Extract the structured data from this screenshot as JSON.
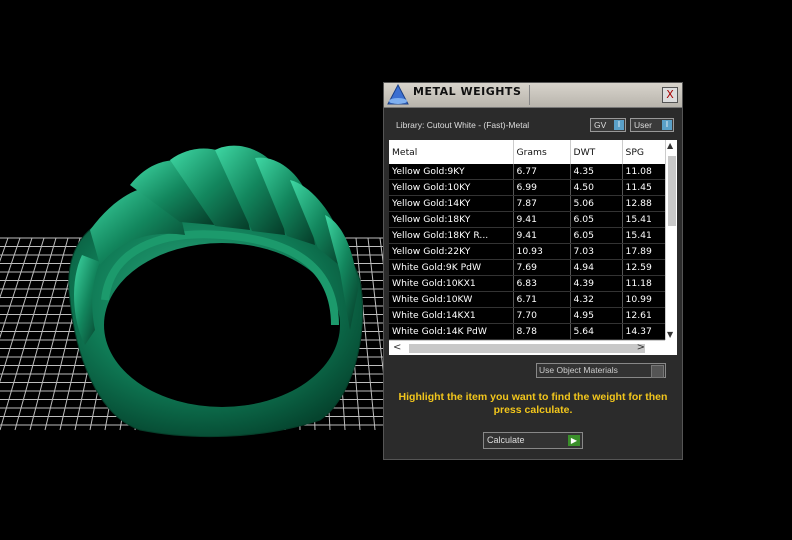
{
  "panel": {
    "title": "METAL WEIGHTS",
    "close_glyph": "X",
    "library_label": "Library: Cutout White - (Fast)-Metal",
    "gv_label": "GV",
    "user_label": "User",
    "toggle_indicator": "I"
  },
  "table": {
    "columns": [
      "Metal",
      "Grams",
      "DWT",
      "SPG"
    ],
    "rows": [
      [
        "Yellow Gold:9KY",
        "6.77",
        "4.35",
        "11.08"
      ],
      [
        "Yellow Gold:10KY",
        "6.99",
        "4.50",
        "11.45"
      ],
      [
        "Yellow Gold:14KY",
        "7.87",
        "5.06",
        "12.88"
      ],
      [
        "Yellow Gold:18KY",
        "9.41",
        "6.05",
        "15.41"
      ],
      [
        "Yellow Gold:18KY R...",
        "9.41",
        "6.05",
        "15.41"
      ],
      [
        "Yellow Gold:22KY",
        "10.93",
        "7.03",
        "17.89"
      ],
      [
        "White Gold:9K PdW",
        "7.69",
        "4.94",
        "12.59"
      ],
      [
        "White Gold:10KX1",
        "6.83",
        "4.39",
        "11.18"
      ],
      [
        "White Gold:10KW",
        "6.71",
        "4.32",
        "10.99"
      ],
      [
        "White Gold:14KX1",
        "7.70",
        "4.95",
        "12.61"
      ],
      [
        "White Gold:14K PdW",
        "8.78",
        "5.64",
        "14.37"
      ]
    ]
  },
  "use_object_materials_label": "Use Object Materials",
  "hint": "Highlight the item you want to find the weight for then press calculate.",
  "calculate_label": "Calculate",
  "colors": {
    "ring": "#0f7a55",
    "grid": "#c8c8c8",
    "hint": "#f2c61c"
  }
}
